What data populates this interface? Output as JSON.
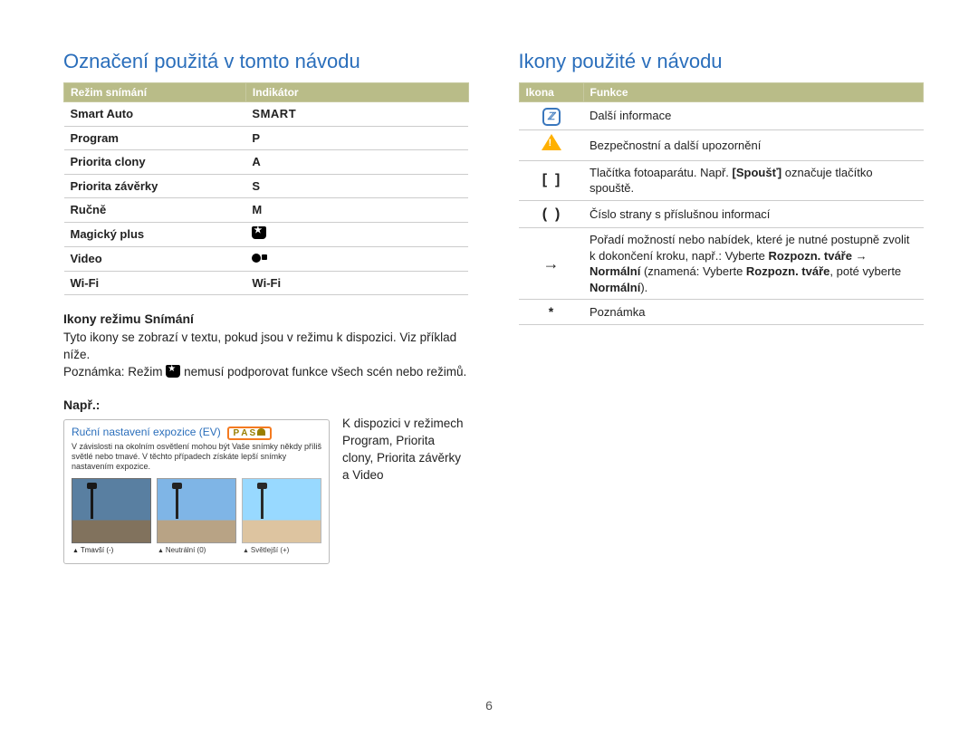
{
  "left": {
    "title": "Označení použitá v tomto návodu",
    "table_headers": {
      "c1": "Režim snímání",
      "c2": "Indikátor"
    },
    "rows": [
      {
        "mode": "Smart Auto",
        "indicator": "SMART",
        "style": "smart"
      },
      {
        "mode": "Program",
        "indicator": "P",
        "style": "letter"
      },
      {
        "mode": "Priorita clony",
        "indicator": "A",
        "style": "letter"
      },
      {
        "mode": "Priorita závěrky",
        "indicator": "S",
        "style": "letter"
      },
      {
        "mode": "Ručně",
        "indicator": "M",
        "style": "letter"
      },
      {
        "mode": "Magický plus",
        "indicator": "",
        "style": "blk"
      },
      {
        "mode": "Video",
        "indicator": "",
        "style": "video"
      },
      {
        "mode": "Wi-Fi",
        "indicator": "Wi-Fi",
        "style": "wifi"
      }
    ],
    "sub1": "Ikony režimu Snímání",
    "para1a": "Tyto ikony se zobrazí v textu, pokud jsou v režimu k dispozici. Viz příklad níže.",
    "para1b_pre": "Poznámka: Režim ",
    "para1b_post": " nemusí podporovat funkce všech scén nebo režimů.",
    "sub2": "Např.:",
    "example_title": "Ruční nastavení expozice (EV)",
    "example_desc": "V závislosti na okolním osvětlení mohou být Vaše snímky někdy příliš světlé nebo tmavé. V těchto případech získáte lepší snímky nastavením expozice.",
    "thumbs": [
      "Tmavší (-)",
      "Neutrální (0)",
      "Světlejší (+)"
    ],
    "side_text": "K dispozici v režimech Program, Priorita clony, Priorita závěrky a Video"
  },
  "right": {
    "title": "Ikony použité v návodu",
    "table_headers": {
      "c1": "Ikona",
      "c2": "Funkce"
    },
    "rows": {
      "info": "Další informace",
      "warn": "Bezpečnostní a další upozornění",
      "brackets": {
        "pre": "Tlačítka fotoaparátu. Např. ",
        "bold": "[Spoušť]",
        "post": " označuje tlačítko spouště."
      },
      "parens": "Číslo strany s příslušnou informací",
      "arrow": {
        "l1": "Pořadí možností nebo nabídek, které je nutné postupně zvolit k dokončení kroku, např.: Vyberte ",
        "b1": "Rozpozn. tváře",
        "mid": " → ",
        "b2": "Normální",
        "paren": " (znamená: Vyberte ",
        "b3": "Rozpozn. tváře",
        "comma": ", poté vyberte ",
        "b4": "Normální",
        "end": ")."
      },
      "star": "Poznámka"
    }
  },
  "pagenum": "6"
}
